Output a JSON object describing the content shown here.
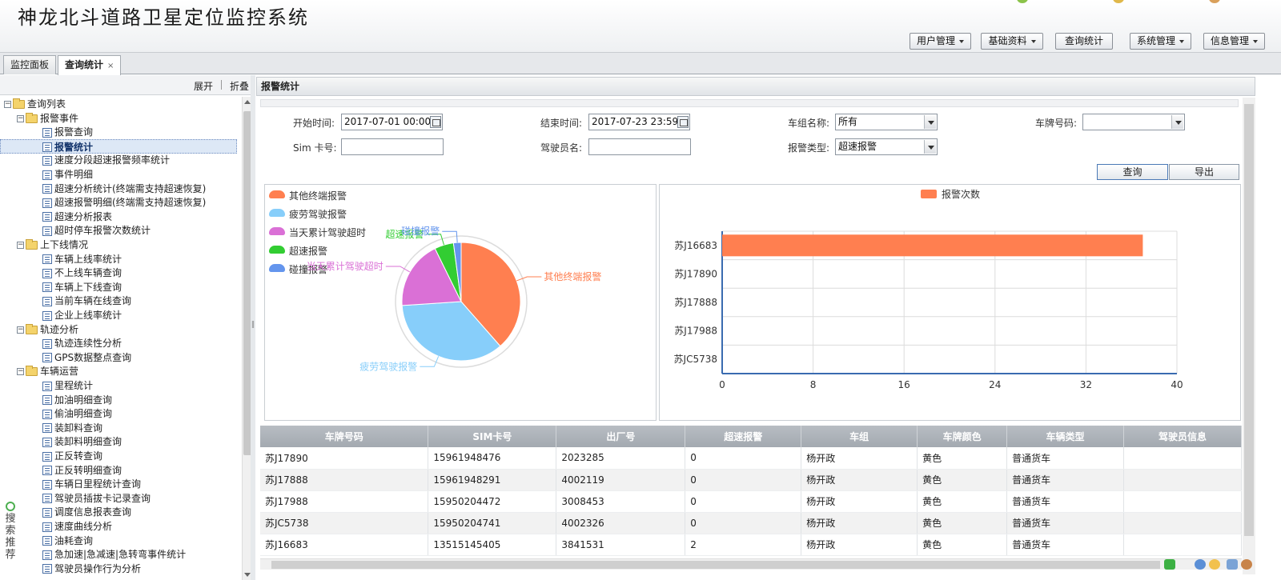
{
  "app": {
    "title": "神龙北斗道路卫星定位监控系统"
  },
  "menu": [
    {
      "label": "用户管理",
      "has_caret": true
    },
    {
      "label": "基础资料",
      "has_caret": true
    },
    {
      "label": "查询统计",
      "has_caret": false
    },
    {
      "label": "系统管理",
      "has_caret": true
    },
    {
      "label": "信息管理",
      "has_caret": true
    }
  ],
  "tabs": [
    {
      "label": "监控面板",
      "active": false
    },
    {
      "label": "查询统计",
      "active": true,
      "close": "×"
    }
  ],
  "left": {
    "expand": "展开",
    "collapse": "折叠",
    "search_recommend": "搜索推荐",
    "tree": [
      {
        "label": "查询列表",
        "level": 0,
        "type": "folder",
        "pm": "−"
      },
      {
        "label": "报警事件",
        "level": 1,
        "type": "folder",
        "pm": "−"
      },
      {
        "label": "报警查询",
        "level": 2,
        "type": "doc"
      },
      {
        "label": "报警统计",
        "level": 2,
        "type": "doc",
        "selected": true
      },
      {
        "label": "速度分段超速报警频率统计",
        "level": 2,
        "type": "doc"
      },
      {
        "label": "事件明细",
        "level": 2,
        "type": "doc"
      },
      {
        "label": "超速分析统计(终端需支持超速恢复)",
        "level": 2,
        "type": "doc"
      },
      {
        "label": "超速报警明细(终端需支持超速恢复)",
        "level": 2,
        "type": "doc"
      },
      {
        "label": "超速分析报表",
        "level": 2,
        "type": "doc"
      },
      {
        "label": "超时停车报警次数统计",
        "level": 2,
        "type": "doc"
      },
      {
        "label": "上下线情况",
        "level": 1,
        "type": "folder",
        "pm": "−"
      },
      {
        "label": "车辆上线率统计",
        "level": 2,
        "type": "doc"
      },
      {
        "label": "不上线车辆查询",
        "level": 2,
        "type": "doc"
      },
      {
        "label": "车辆上下线查询",
        "level": 2,
        "type": "doc"
      },
      {
        "label": "当前车辆在线查询",
        "level": 2,
        "type": "doc"
      },
      {
        "label": "企业上线率统计",
        "level": 2,
        "type": "doc"
      },
      {
        "label": "轨迹分析",
        "level": 1,
        "type": "folder",
        "pm": "−"
      },
      {
        "label": "轨迹连续性分析",
        "level": 2,
        "type": "doc"
      },
      {
        "label": "GPS数据整点查询",
        "level": 2,
        "type": "doc"
      },
      {
        "label": "车辆运营",
        "level": 1,
        "type": "folder",
        "pm": "−"
      },
      {
        "label": "里程统计",
        "level": 2,
        "type": "doc"
      },
      {
        "label": "加油明细查询",
        "level": 2,
        "type": "doc"
      },
      {
        "label": "偷油明细查询",
        "level": 2,
        "type": "doc"
      },
      {
        "label": "装卸料查询",
        "level": 2,
        "type": "doc"
      },
      {
        "label": "装卸料明细查询",
        "level": 2,
        "type": "doc"
      },
      {
        "label": "正反转查询",
        "level": 2,
        "type": "doc"
      },
      {
        "label": "正反转明细查询",
        "level": 2,
        "type": "doc"
      },
      {
        "label": "车辆日里程统计查询",
        "level": 2,
        "type": "doc"
      },
      {
        "label": "驾驶员插拔卡记录查询",
        "level": 2,
        "type": "doc"
      },
      {
        "label": "调度信息报表查询",
        "level": 2,
        "type": "doc"
      },
      {
        "label": "速度曲线分析",
        "level": 2,
        "type": "doc"
      },
      {
        "label": "油耗查询",
        "level": 2,
        "type": "doc"
      },
      {
        "label": "急加速|急减速|急转弯事件统计",
        "level": 2,
        "type": "doc"
      },
      {
        "label": "驾驶员操作行为分析",
        "level": 2,
        "type": "doc"
      }
    ]
  },
  "content": {
    "header": "报警统计",
    "filters": {
      "start_label": "开始时间:",
      "start_value": "2017-07-01 00:00",
      "end_label": "结束时间:",
      "end_value": "2017-07-23 23:59",
      "group_label": "车组名称:",
      "group_value": "所有",
      "plate_label": "车牌号码:",
      "plate_value": "",
      "sim_label": "Sim 卡号:",
      "sim_value": "",
      "driver_label": "驾驶员名:",
      "driver_value": "",
      "alarm_type_label": "报警类型:",
      "alarm_type_value": "超速报警"
    },
    "buttons": {
      "query": "查询",
      "export": "导出"
    }
  },
  "chart_data": [
    {
      "type": "pie",
      "legend": [
        {
          "name": "其他终端报警",
          "color": "#ff7f50"
        },
        {
          "name": "疲劳驾驶报警",
          "color": "#87cefa"
        },
        {
          "name": "当天累计驾驶超时",
          "color": "#da70d6"
        },
        {
          "name": "超速报警",
          "color": "#32cd32"
        },
        {
          "name": "碰撞报警",
          "color": "#6495ed"
        }
      ],
      "slices": [
        {
          "name": "其他终端报警",
          "value": 37,
          "color": "#ff7f50"
        },
        {
          "name": "疲劳驾驶报警",
          "value": 34,
          "color": "#87cefa"
        },
        {
          "name": "当天累计驾驶超时",
          "value": 18,
          "color": "#da70d6"
        },
        {
          "name": "超速报警",
          "value": 5,
          "color": "#32cd32"
        },
        {
          "name": "碰撞报警",
          "value": 2,
          "color": "#6495ed"
        }
      ]
    },
    {
      "type": "bar",
      "orientation": "horizontal",
      "legend": "报警次数",
      "color": "#ff7f50",
      "categories": [
        "苏J16683",
        "苏J17890",
        "苏J17888",
        "苏J17988",
        "苏JC5738"
      ],
      "values": [
        37,
        0,
        0,
        0,
        0
      ],
      "xlim": [
        0,
        40
      ],
      "xticks": [
        0,
        8,
        16,
        24,
        32,
        40
      ],
      "grid": true
    }
  ],
  "table": {
    "columns": [
      "车牌号码",
      "SIM卡号",
      "出厂号",
      "超速报警",
      "车组",
      "车牌颜色",
      "车辆类型",
      "驾驶员信息"
    ],
    "rows": [
      [
        "苏J17890",
        "15961948476",
        "2023285",
        "0",
        "杨开政",
        "黄色",
        "普通货车",
        ""
      ],
      [
        "苏J17888",
        "15961948291",
        "4002119",
        "0",
        "杨开政",
        "黄色",
        "普通货车",
        ""
      ],
      [
        "苏J17988",
        "15950204472",
        "3008453",
        "0",
        "杨开政",
        "黄色",
        "普通货车",
        ""
      ],
      [
        "苏JC5738",
        "15950204741",
        "4002326",
        "0",
        "杨开政",
        "黄色",
        "普通货车",
        ""
      ],
      [
        "苏J16683",
        "13515145405",
        "3841531",
        "2",
        "杨开政",
        "黄色",
        "普通货车",
        ""
      ]
    ]
  }
}
